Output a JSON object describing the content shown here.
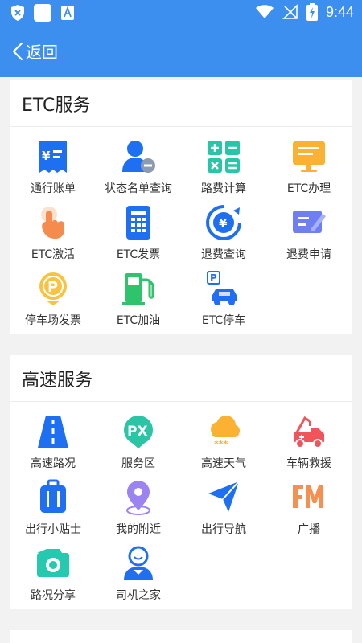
{
  "status_bar": {
    "time": "9:44",
    "left_icons": [
      "shield-x-icon",
      "white-square-icon",
      "font-a-icon"
    ],
    "right_icons": [
      "wifi-icon",
      "no-signal-icon",
      "battery-charging-icon"
    ]
  },
  "header": {
    "back_label": "返回",
    "bg_color": "#3d8fef"
  },
  "sections": [
    {
      "title": "ETC服务",
      "items": [
        {
          "label": "通行账单",
          "icon": "bill-icon"
        },
        {
          "label": "状态名单查询",
          "icon": "user-minus-icon"
        },
        {
          "label": "路费计算",
          "icon": "calculator-icon"
        },
        {
          "label": "ETC办理",
          "icon": "monitor-icon"
        },
        {
          "label": "ETC激活",
          "icon": "tap-hand-icon"
        },
        {
          "label": "ETC发票",
          "icon": "phone-invoice-icon"
        },
        {
          "label": "退费查询",
          "icon": "yen-refresh-icon"
        },
        {
          "label": "退费申请",
          "icon": "form-edit-icon"
        },
        {
          "label": "停车场发票",
          "icon": "parking-coin-icon"
        },
        {
          "label": "ETC加油",
          "icon": "fuel-pump-icon"
        },
        {
          "label": "ETC停车",
          "icon": "parking-car-icon"
        }
      ]
    },
    {
      "title": "高速服务",
      "items": [
        {
          "label": "高速路况",
          "icon": "highway-road-icon"
        },
        {
          "label": "服务区",
          "icon": "px-badge-icon"
        },
        {
          "label": "高速天气",
          "icon": "weather-cloud-icon"
        },
        {
          "label": "车辆救援",
          "icon": "tow-truck-icon"
        },
        {
          "label": "出行小贴士",
          "icon": "luggage-icon"
        },
        {
          "label": "我的附近",
          "icon": "location-pin-icon"
        },
        {
          "label": "出行导航",
          "icon": "navigation-arrow-icon"
        },
        {
          "label": "广播",
          "icon": "fm-radio-icon"
        },
        {
          "label": "路况分享",
          "icon": "camera-icon"
        },
        {
          "label": "司机之家",
          "icon": "driver-icon"
        }
      ]
    }
  ]
}
